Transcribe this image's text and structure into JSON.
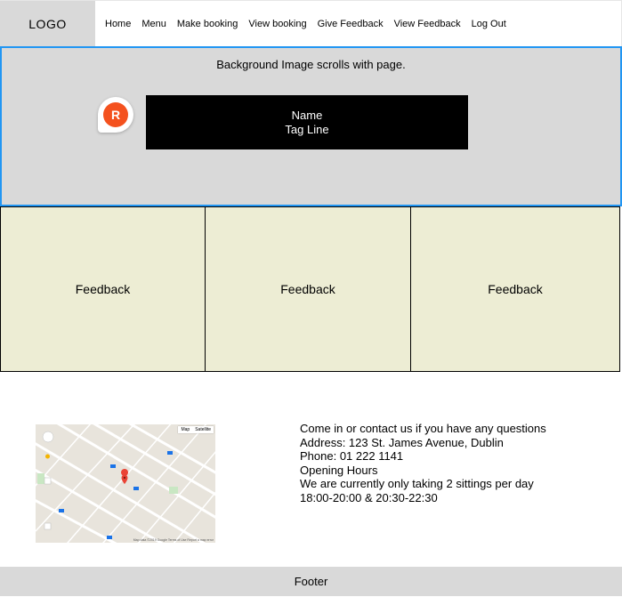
{
  "header": {
    "logo": "LOGO",
    "nav": [
      "Home",
      "Menu",
      "Make booking",
      "View booking",
      "Give Feedback",
      "View Feedback",
      "Log Out"
    ]
  },
  "hero": {
    "note": "Background Image scrolls with page.",
    "avatar_letter": "R",
    "name": "Name",
    "tagline": "Tag Line"
  },
  "feedback": [
    "Feedback",
    "Feedback",
    "Feedback"
  ],
  "map": {
    "type_map": "Map",
    "type_satellite": "Satellite",
    "footer_text": "Map data ©2019 Google   Terms of Use   Report a map error"
  },
  "contact": {
    "intro": "Come in or contact us if you have any questions",
    "address": "Address: 123 St. James Avenue, Dublin",
    "phone": "Phone: 01 222 1141",
    "hours_heading": "Opening Hours",
    "sittings": "We are currently only taking 2 sittings per day",
    "times": "18:00-20:00 & 20:30-22:30"
  },
  "footer": {
    "text": "Footer"
  },
  "colors": {
    "grey": "#d9d9d9",
    "hero_border": "#2196f3",
    "feedback_bg": "#ededd4",
    "avatar": "#f4511e",
    "name_box": "#000000"
  }
}
